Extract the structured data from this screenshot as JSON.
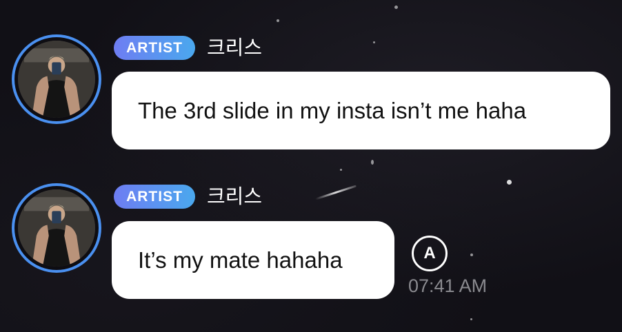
{
  "messages": [
    {
      "badge": "ARTIST",
      "sender": "크리스",
      "text": "The 3rd slide in my insta isn’t me haha"
    },
    {
      "badge": "ARTIST",
      "sender": "크리스",
      "text": "It’s my mate hahaha",
      "timestamp": "07:41 AM",
      "translate_icon": "A"
    }
  ],
  "colors": {
    "background": "#111016",
    "bubble": "#ffffff",
    "badge_start": "#6e7df2",
    "badge_end": "#4aa8ee",
    "avatar_ring": "#4a90f0",
    "timestamp": "#8a8a8f"
  },
  "icons": {
    "translate": "translate-icon"
  }
}
